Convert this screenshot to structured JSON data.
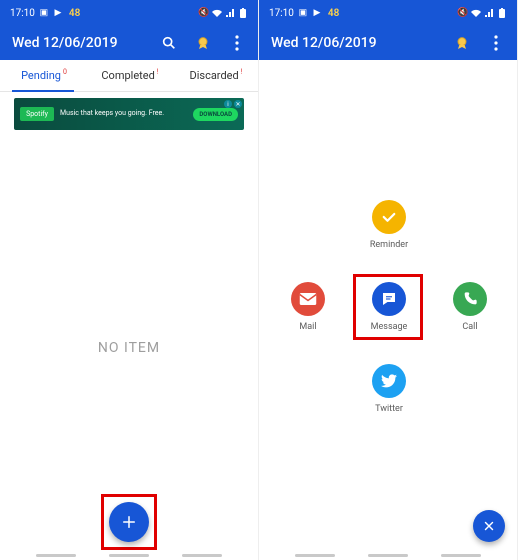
{
  "status": {
    "time": "17:10",
    "badge": "48"
  },
  "header": {
    "date": "Wed 12/06/2019"
  },
  "tabs": {
    "pending": "Pending",
    "completed": "Completed",
    "discarded": "Discarded"
  },
  "ad": {
    "brand": "Spotify",
    "line": "Music that keeps you going. Free.",
    "cta": "DOWNLOAD"
  },
  "empty": "NO ITEM",
  "actions": {
    "reminder": "Reminder",
    "mail": "Mail",
    "message": "Message",
    "call": "Call",
    "twitter": "Twitter"
  }
}
